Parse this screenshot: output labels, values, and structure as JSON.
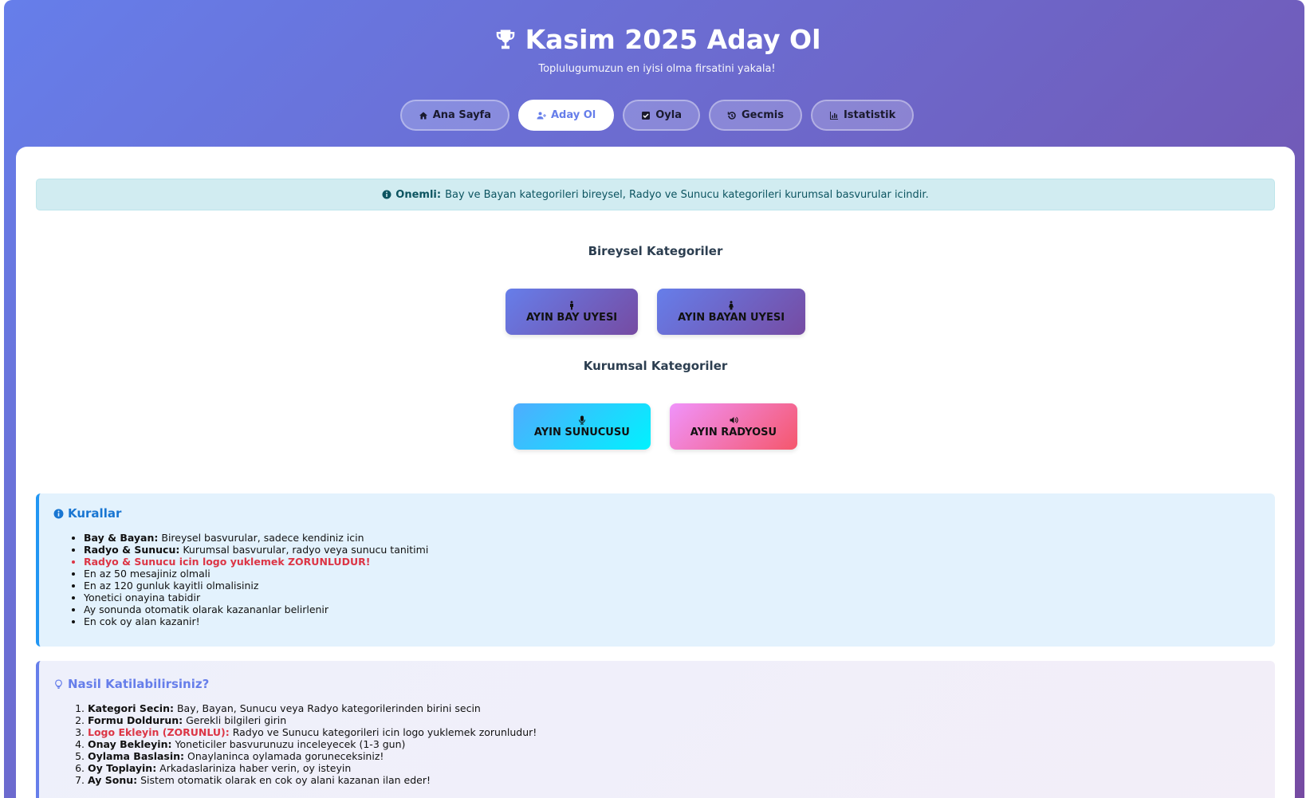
{
  "header": {
    "title": "Kasim 2025 Aday Ol",
    "subtitle": "Toplulugumuzun en iyisi olma firsatini yakala!"
  },
  "nav": {
    "tabs": [
      {
        "label": "Ana Sayfa",
        "icon": "home-icon"
      },
      {
        "label": "Aday Ol",
        "icon": "user-plus-icon",
        "active": true
      },
      {
        "label": "Oyla",
        "icon": "check-square-icon"
      },
      {
        "label": "Gecmis",
        "icon": "history-icon"
      },
      {
        "label": "Istatistik",
        "icon": "bar-chart-icon"
      }
    ]
  },
  "alert": {
    "label": "Onemli:",
    "text": "Bay ve Bayan kategorileri bireysel, Radyo ve Sunucu kategorileri kurumsal basvurular icindir."
  },
  "individual": {
    "title": "Bireysel Kategoriler",
    "buttons": [
      {
        "label": "AYIN BAY UYESI",
        "icon": "male-icon"
      },
      {
        "label": "AYIN BAYAN UYESI",
        "icon": "female-icon"
      }
    ]
  },
  "corporate": {
    "title": "Kurumsal Kategoriler",
    "buttons": [
      {
        "label": "AYIN SUNUCUSU",
        "icon": "microphone-icon"
      },
      {
        "label": "AYIN RADYOSU",
        "icon": "volume-icon"
      }
    ]
  },
  "rules": {
    "title": "Kurallar",
    "items": [
      {
        "bold": "Bay & Bayan:",
        "text": " Bireysel basvurular, sadece kendiniz icin"
      },
      {
        "bold": "Radyo & Sunucu:",
        "text": " Kurumsal basvurular, radyo veya sunucu tanitimi"
      },
      {
        "text": "Radyo & Sunucu icin logo yuklemek ZORUNLUDUR!"
      },
      {
        "text": "En az 50 mesajiniz olmali"
      },
      {
        "text": "En az 120 gunluk kayitli olmalisiniz"
      },
      {
        "text": "Yonetici onayina tabidir"
      },
      {
        "text": "Ay sonunda otomatik olarak kazananlar belirlenir"
      },
      {
        "text": "En cok oy alan kazanir!"
      }
    ]
  },
  "howto": {
    "title": "Nasil Katilabilirsiniz?",
    "steps": [
      {
        "bold": "Kategori Secin:",
        "text": " Bay, Bayan, Sunucu veya Radyo kategorilerinden birini secin"
      },
      {
        "bold": "Formu Doldurun:",
        "text": " Gerekli bilgileri girin"
      },
      {
        "bold": "Logo Ekleyin (ZORUNLU):",
        "text": " Radyo ve Sunucu kategorileri icin logo yuklemek zorunludur!"
      },
      {
        "bold": "Onay Bekleyin:",
        "text": " Yoneticiler basvurunuzu inceleyecek (1-3 gun)"
      },
      {
        "bold": "Oylama Baslasin:",
        "text": " Onaylaninca oylamada goruneceksiniz!"
      },
      {
        "bold": "Oy Toplayin:",
        "text": " Arkadaslariniza haber verin, oy isteyin"
      },
      {
        "bold": "Ay Sonu:",
        "text": " Sistem otomatik olarak en cok oy alani kazanan ilan eder!"
      }
    ]
  },
  "colors": {
    "brand_gradient_start": "#667eea",
    "brand_gradient_end": "#764ba2",
    "alert_bg": "#d1ecf1",
    "rules_bg": "#e3f2fd",
    "required_red": "#dc3545"
  }
}
